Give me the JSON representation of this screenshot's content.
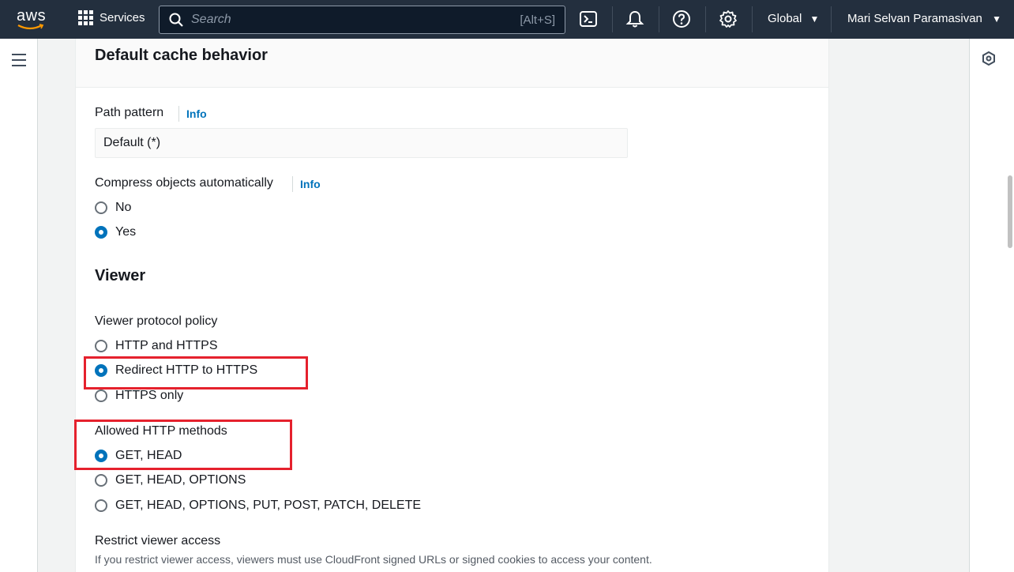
{
  "nav": {
    "logo_text": "aws",
    "services_label": "Services",
    "search_placeholder": "Search",
    "search_shortcut": "[Alt+S]",
    "region_label": "Global",
    "user_label": "Mari Selvan Paramasivan"
  },
  "card": {
    "title": "Default cache behavior",
    "path_pattern": {
      "label": "Path pattern",
      "info": "Info",
      "value": "Default (*)"
    },
    "compress": {
      "label": "Compress objects automatically",
      "info": "Info",
      "options": [
        "No",
        "Yes"
      ],
      "selected": "Yes"
    },
    "viewer": {
      "title": "Viewer",
      "protocol_policy": {
        "label": "Viewer protocol policy",
        "options": [
          "HTTP and HTTPS",
          "Redirect HTTP to HTTPS",
          "HTTPS only"
        ],
        "selected": "Redirect HTTP to HTTPS"
      },
      "allowed_methods": {
        "label": "Allowed HTTP methods",
        "options": [
          "GET, HEAD",
          "GET, HEAD, OPTIONS",
          "GET, HEAD, OPTIONS, PUT, POST, PATCH, DELETE"
        ],
        "selected": "GET, HEAD"
      },
      "restrict_access": {
        "label": "Restrict viewer access",
        "description": "If you restrict viewer access, viewers must use CloudFront signed URLs or signed cookies to access your content."
      }
    }
  },
  "colors": {
    "nav_bg": "#232f3e",
    "link": "#0073bb",
    "radio_selected": "#0073bb",
    "highlight": "#e5212d"
  }
}
